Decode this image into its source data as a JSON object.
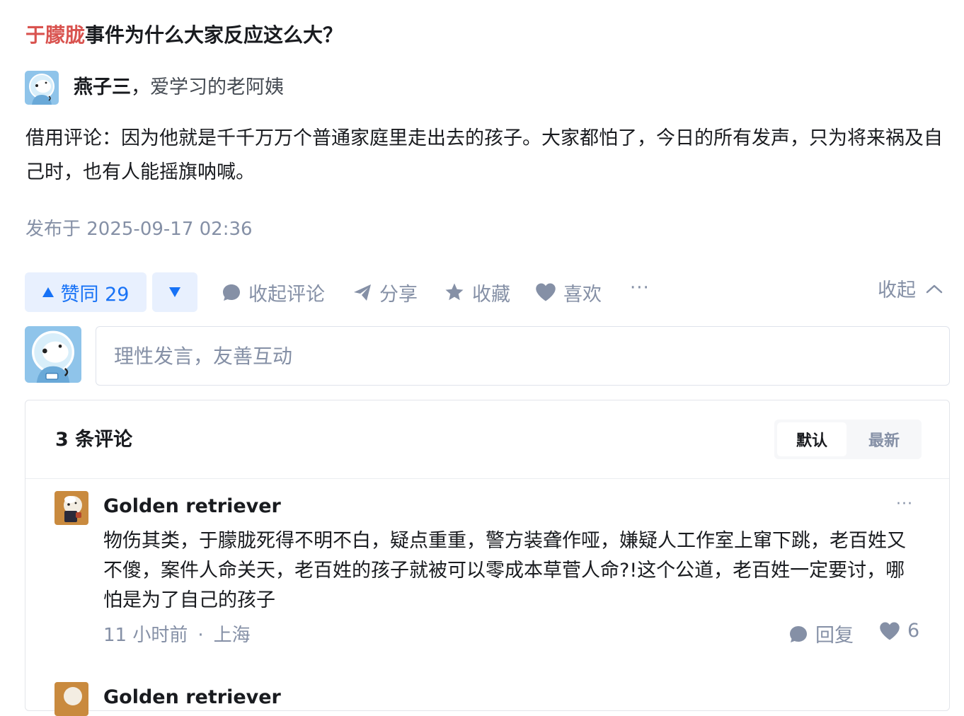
{
  "question": {
    "title_highlight": "于朦胧",
    "title_rest": "事件为什么大家反应这么大？"
  },
  "answer": {
    "author_name": "燕子三",
    "author_sep": "，",
    "author_bio": "爱学习的老阿姨",
    "content": "借用评论：因为他就是千千万万个普通家庭里走出去的孩子。大家都怕了，今日的所有发声，只为将来祸及自己时，也有人能摇旗呐喊。",
    "published": "发布于 2025-09-17 02:36"
  },
  "actions": {
    "upvote_label": "赞同 29",
    "collapse_comments": "收起评论",
    "share": "分享",
    "favorite": "收藏",
    "like": "喜欢",
    "more": "···",
    "collapse": "收起"
  },
  "comment_box": {
    "placeholder": "理性发言，友善互动"
  },
  "comments": {
    "count_label": "3 条评论",
    "sort_default": "默认",
    "sort_newest": "最新",
    "items": [
      {
        "author": "Golden retriever",
        "text": "物伤其类，于朦胧死得不明不白，疑点重重，警方装聋作哑，嫌疑人工作室上窜下跳，老百姓又不傻，案件人命关天，老百姓的孩子就被可以零成本草菅人命?!这个公道，老百姓一定要讨，哪怕是为了自己的孩子",
        "time": "11 小时前",
        "dot": "·",
        "location": "上海",
        "reply_label": "回复",
        "likes": "6",
        "more": "···"
      },
      {
        "author": "Golden retriever"
      }
    ]
  },
  "colors": {
    "accent": "#1772f6",
    "highlight": "#d9534f",
    "muted": "#8590a6",
    "vote_bg": "#e8f0fe"
  }
}
